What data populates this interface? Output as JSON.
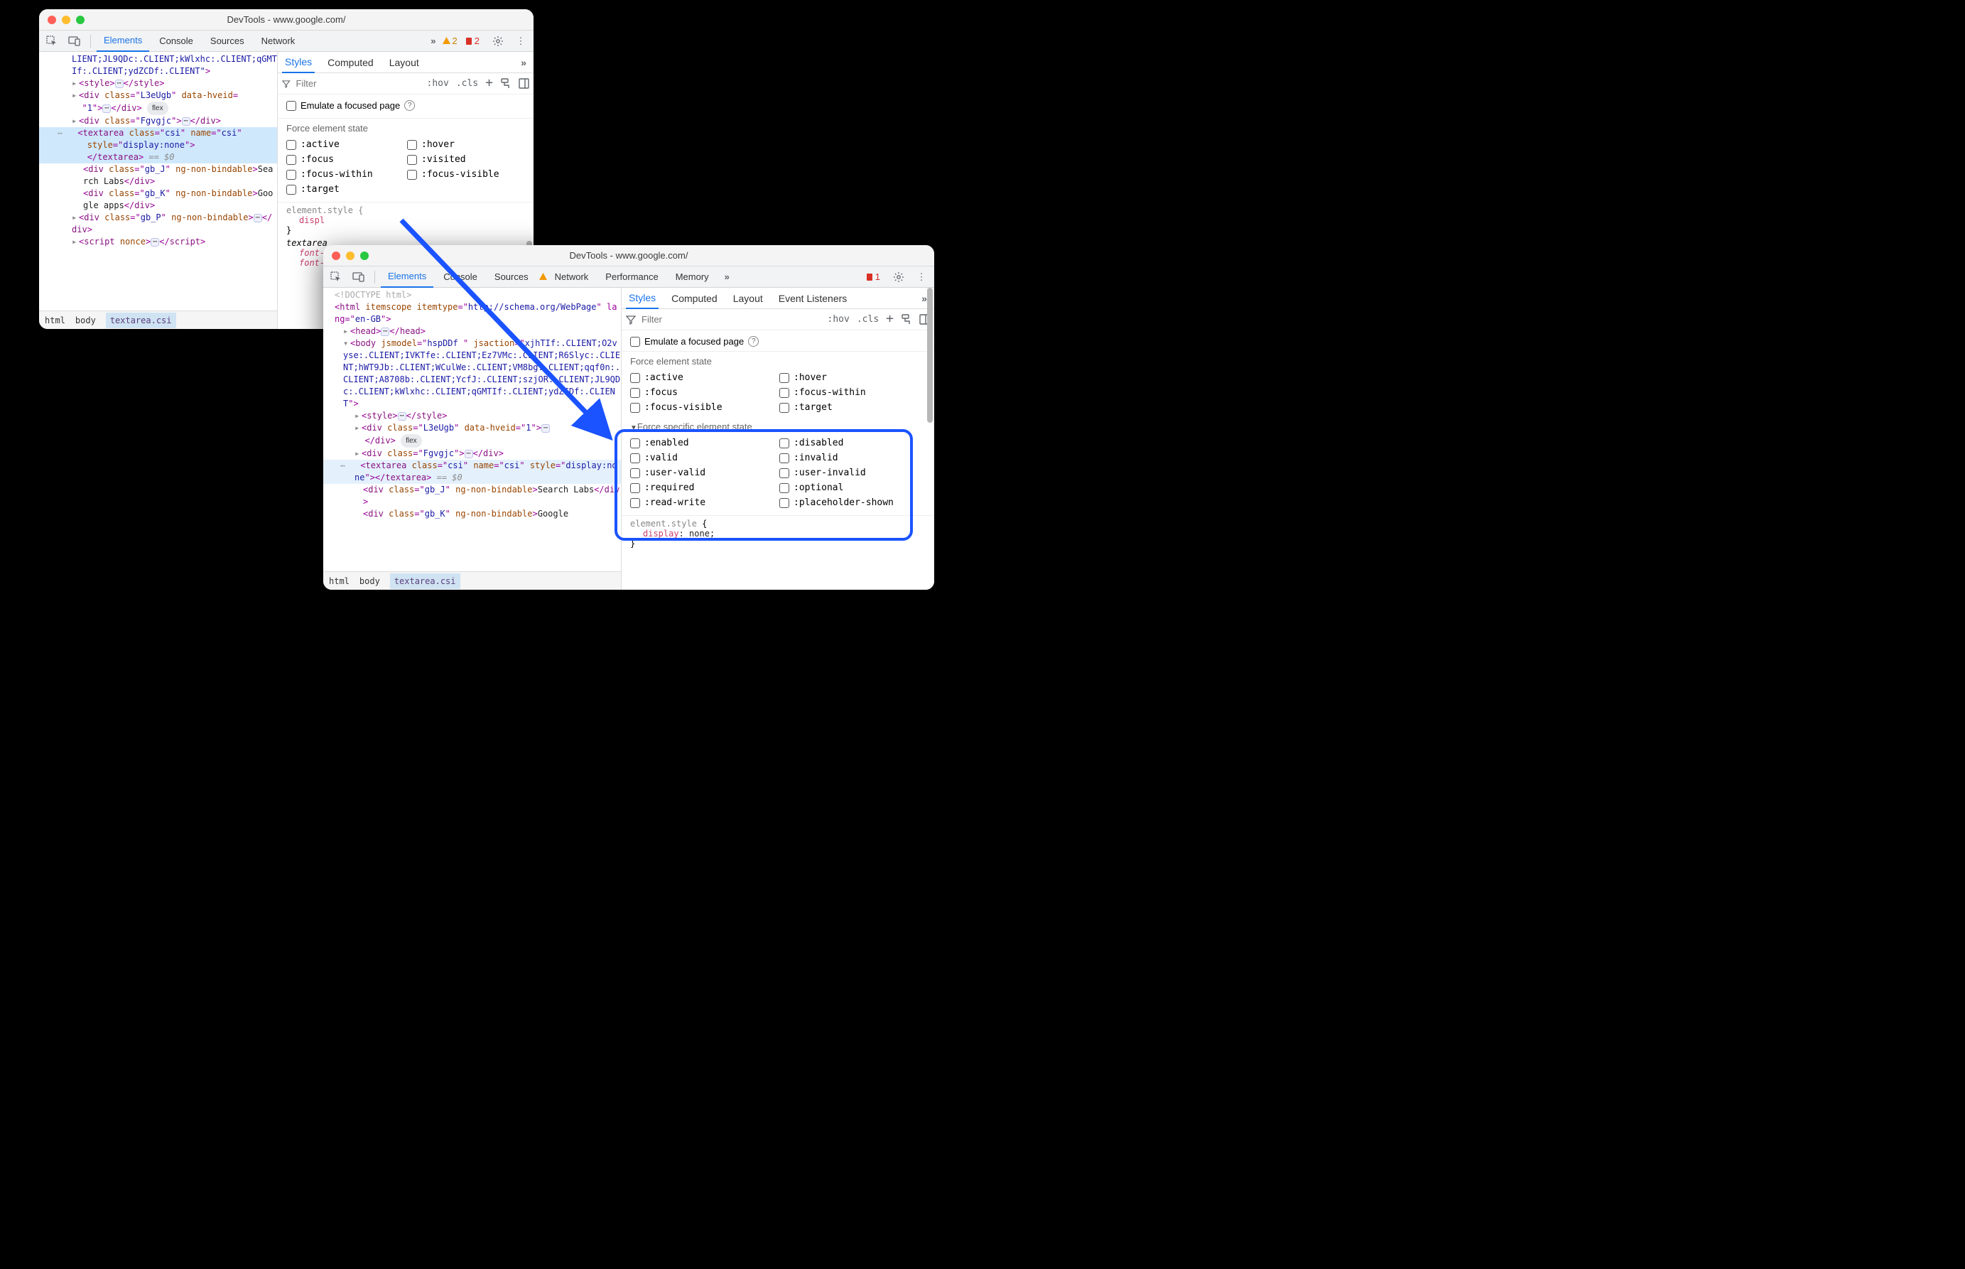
{
  "win1": {
    "title": "DevTools - www.google.com/",
    "tabs": {
      "elements": "Elements",
      "console": "Console",
      "sources": "Sources",
      "network": "Network"
    },
    "badges": {
      "warn_count": "2",
      "error_count": "2"
    },
    "dom": {
      "line1": "LIENT;JL9QDc:.CLIENT;kWlxhc:.CLIENT;qGMTIf:.CLIENT;ydZCDf:.CLIENT\"",
      "style_tag": "style",
      "div_l3eugb_open": "div",
      "attr_class": "class",
      "l3eugb": "L3eUgb",
      "attr_datahveid": "data-hveid",
      "one": "1",
      "fg_open": "div",
      "fgvgjc": "Fgvgjc",
      "ta_tag": "textarea",
      "csi": "csi",
      "attr_name": "name",
      "attr_style": "style",
      "disp_none": "display:none",
      "eq0": "== $0",
      "gbj": "gb_J",
      "ngnon": "ng-non-bindable",
      "searchlabs": "Search Labs",
      "gbk": "gb_K",
      "googleapps": "Google apps",
      "gbp": "gb_P",
      "script": "script",
      "nonce": "nonce"
    },
    "crumbs": {
      "html": "html",
      "body": "body",
      "ta": "textarea.csi"
    },
    "styles": {
      "tabs": {
        "styles": "Styles",
        "computed": "Computed",
        "layout": "Layout"
      },
      "filter_ph": "Filter",
      "hov": ":hov",
      "cls": ".cls",
      "emu_label": "Emulate a focused page",
      "force_label": "Force element state",
      "states": {
        "active": ":active",
        "hover": ":hover",
        "focus": ":focus",
        "visited": ":visited",
        "focuswithin": ":focus-within",
        "focusvisible": ":focus-visible",
        "target": ":target"
      },
      "elstyle": "element.style {",
      "disp": "displ",
      "close": "}",
      "textarea_sel": "textarea",
      "font_prop": "font-"
    }
  },
  "win2": {
    "title": "DevTools - www.google.com/",
    "tabs": {
      "elements": "Elements",
      "console": "Console",
      "sources": "Sources",
      "network": "Network",
      "performance": "Performance",
      "memory": "Memory"
    },
    "badges": {
      "error_count": "1"
    },
    "dom": {
      "doctype": "<!DOCTYPE html>",
      "html_open": "<html itemscope itemtype=\"",
      "schema_url": "http://schema.org/WebPage",
      "html_lang": "\" lang=\"",
      "en_gb": "en-GB",
      "html_end": "\">",
      "head": "head",
      "body_open": "body",
      "jsmodel_attr": "jsmodel",
      "jsmodel_val": "hspDDf ",
      "jsaction_attr": "jsaction",
      "jsaction_val": "xjhTIf:.CLIENT;O2vyse:.CLIENT;IVKTfe:.CLIENT;Ez7VMc:.CLIENT;R6Slyc:.CLIENT;hWT9Jb:.CLIENT;WCulWe:.CLIENT;VM8bg:.CLIENT;qqf0n:.CLIENT;A8708b:.CLIENT;YcfJ:.CLIENT;szjOR:.CLIENT;JL9QDc:.CLIENT;kWlxhc:.CLIENT;qGMTIf:.CLIENT;ydZCDf:.CLIENT",
      "l3eugb": "L3eUgb",
      "datahveid": "data-hveid",
      "one": "1",
      "fgvgjc": "Fgvgjc",
      "csi": "csi",
      "style_disp": "display:none",
      "eq0": "== $0",
      "gbj": "gb_J",
      "ngnon": "ng-non-bindable",
      "searchlabs": "Search Labs",
      "gbk": "gb_K",
      "google": "Google",
      "flex_pill": "flex"
    },
    "crumbs": {
      "html": "html",
      "body": "body",
      "ta": "textarea.csi"
    },
    "styles": {
      "tabs": {
        "styles": "Styles",
        "computed": "Computed",
        "layout": "Layout",
        "evlisteners": "Event Listeners"
      },
      "filter_ph": "Filter",
      "hov": ":hov",
      "cls": ".cls",
      "emu_label": "Emulate a focused page",
      "force_label": "Force element state",
      "states": {
        "active": ":active",
        "hover": ":hover",
        "focus": ":focus",
        "focuswithin": ":focus-within",
        "focusvisible": ":focus-visible",
        "target": ":target"
      },
      "force_specific_label": "Force specific element state",
      "specific_states": {
        "enabled": ":enabled",
        "disabled": ":disabled",
        "valid": ":valid",
        "invalid": ":invalid",
        "uservalid": ":user-valid",
        "userinvalid": ":user-invalid",
        "required": ":required",
        "optional": ":optional",
        "readwrite": ":read-write",
        "placeholdershown": ":placeholder-shown"
      },
      "elstyle_sel": "element.style",
      "open_brace": " {",
      "disp_prop": "display",
      "disp_val": "none",
      "close_brace": "}"
    }
  }
}
